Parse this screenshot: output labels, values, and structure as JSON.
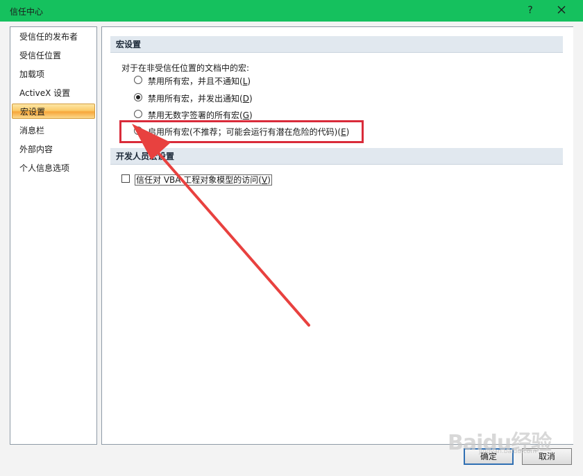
{
  "window": {
    "title": "信任中心",
    "help": "?"
  },
  "sidebar": {
    "items": [
      {
        "label": "受信任的发布者"
      },
      {
        "label": "受信任位置"
      },
      {
        "label": "加载项"
      },
      {
        "label": "ActiveX 设置"
      },
      {
        "label": "宏设置",
        "selected": true
      },
      {
        "label": "消息栏"
      },
      {
        "label": "外部内容"
      },
      {
        "label": "个人信息选项"
      }
    ]
  },
  "macro_section": {
    "header": "宏设置",
    "prompt": "对于在非受信任位置的文档中的宏:",
    "options": [
      {
        "text": "禁用所有宏，并且不通知",
        "key": "L",
        "checked": false
      },
      {
        "text": "禁用所有宏，并发出通知",
        "key": "D",
        "checked": true
      },
      {
        "text": "禁用无数字签署的所有宏",
        "key": "G",
        "checked": false
      },
      {
        "text": "启用所有宏(不推荐；可能会运行有潜在危险的代码)",
        "key": "E",
        "checked": false
      }
    ]
  },
  "developer_section": {
    "header": "开发人员宏设置",
    "checkbox_text": "信任对 VBA 工程对象模型的访问",
    "checkbox_key": "V",
    "checked": false
  },
  "buttons": {
    "ok": "确定",
    "cancel": "取消"
  },
  "annotation": {
    "color": "#d92b3a"
  },
  "watermark": {
    "main": "Baidu经验",
    "sub": "jingyan.baidu.com"
  },
  "colors": {
    "titlebar": "#15c15e",
    "selected_item": "#fbcb6a",
    "section_header": "#e1e8ef"
  }
}
